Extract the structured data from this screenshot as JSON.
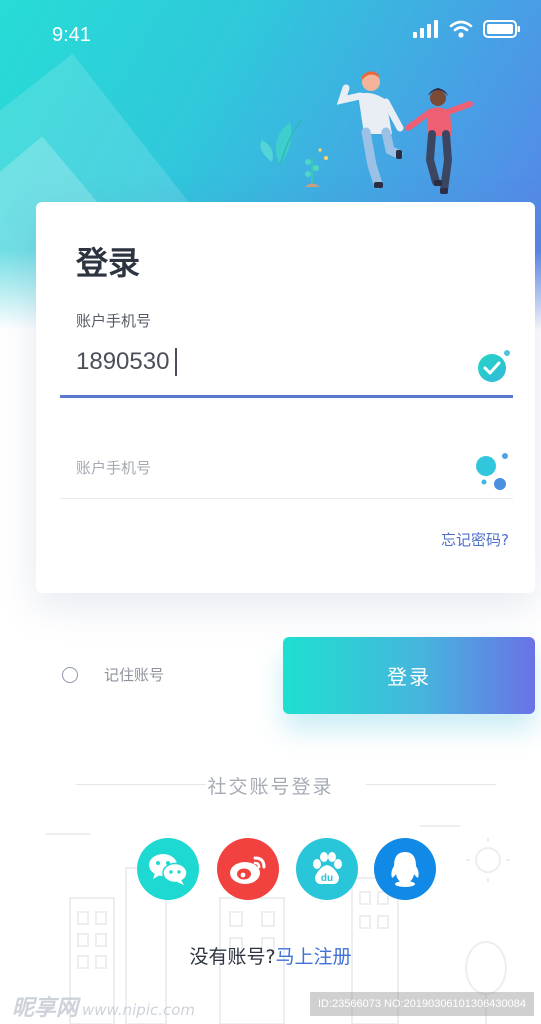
{
  "status_bar": {
    "time": "9:41"
  },
  "card": {
    "title": "登录",
    "field1_label": "账户手机号",
    "field1_value": "1890530",
    "field2_placeholder": "账户手机号",
    "forgot_password": "忘记密码?"
  },
  "remember": {
    "label": "记住账号",
    "checked": false
  },
  "login_button": {
    "label": "登录"
  },
  "social": {
    "title": "社交账号登录",
    "items": [
      {
        "name": "wechat",
        "icon": "wechat-icon",
        "color": "#1ed9d2"
      },
      {
        "name": "weibo",
        "icon": "weibo-icon",
        "color": "#f2423f"
      },
      {
        "name": "baidu",
        "icon": "baidu-icon",
        "color": "#29c5d9"
      },
      {
        "name": "qq",
        "icon": "qq-icon",
        "color": "#1189e6"
      }
    ]
  },
  "register": {
    "prompt": "没有账号?",
    "link": "马上注册"
  },
  "watermark": {
    "brand": "昵享网",
    "url": "www.nipic.com",
    "id_text": "ID:23566073 NO:20190306101306430084"
  },
  "colors": {
    "accent": "#5b78d0",
    "link": "#4f6fc9",
    "gradient_start": "#1ee0d0",
    "gradient_end": "#6a72e6"
  }
}
